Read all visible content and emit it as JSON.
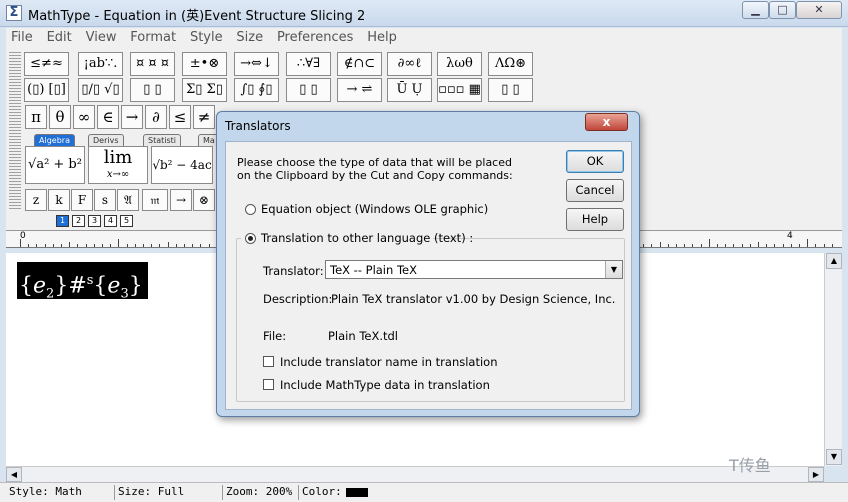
{
  "window": {
    "title": "MathType - Equation in (英)Event Structure Slicing 2",
    "app_icon": "Σ",
    "buttons": {
      "minimize": "▁",
      "maximize": "□",
      "close": "✕"
    }
  },
  "menu": [
    "File",
    "Edit",
    "View",
    "Format",
    "Style",
    "Size",
    "Preferences",
    "Help"
  ],
  "palette": {
    "row1": [
      "≤≠≈",
      "¡ab∵.",
      "¤ ¤ ¤",
      "±•⊗",
      "→⇔↓",
      "∴∀∃",
      "∉∩⊂",
      "∂∞ℓ",
      "λωθ",
      "ΛΩ⊛"
    ],
    "row2": [
      "(▯) [▯]",
      "▯/▯ √▯",
      "▯ ▯",
      "Σ▯ Σ▯",
      "∫▯ ∮▯",
      "▯ ▯",
      "→ ⇌",
      "Ū Ụ",
      "▫▫▫ ▦",
      "▯ ▯"
    ],
    "row3": [
      "π",
      "θ",
      "∞",
      "∈",
      "→",
      "∂",
      "≤",
      "≠"
    ],
    "tabs": [
      "Algebra",
      "Derivs",
      "Statisti",
      "Ma"
    ],
    "templates": {
      "sqrt_sum": "√a² + b²",
      "lim_top": "lim",
      "lim_bottom": "x→∞",
      "sqrt_disc": "√b² − 4ac"
    },
    "row5": [
      "z",
      "k",
      "F",
      "s",
      "𝔄",
      "𝔪",
      "→",
      "⊗"
    ],
    "size_tabs": [
      "1",
      "2",
      "3",
      "4",
      "5"
    ]
  },
  "ruler": {
    "start": "0",
    "end": "4"
  },
  "document": {
    "equation": {
      "e1_base": "e",
      "e1_sub": "2",
      "op": "#",
      "op_sup": "s",
      "e2_base": "e",
      "e2_sub": "3"
    },
    "watermark": "T传鱼"
  },
  "status": {
    "style": "Style: Math",
    "size": "Size: Full",
    "zoom": "Zoom: 200%",
    "color_label": "Color:",
    "color_value": "#000000"
  },
  "dialog": {
    "title": "Translators",
    "close_label": "x",
    "prompt_line1": "Please choose the type of data that will be placed",
    "prompt_line2": "on the Clipboard by the Cut and Copy commands:",
    "ok_label": "OK",
    "cancel_label": "Cancel",
    "help_label": "Help",
    "option_ole": "Equation object (Windows OLE graphic)",
    "option_translation": "Translation to other language (text) :",
    "selected_option": "translation",
    "translator_label": "Translator:",
    "translator_value": "TeX -- Plain TeX",
    "description_label": "Description:",
    "description_value": "Plain TeX translator v1.00 by Design Science, Inc.",
    "file_label": "File:",
    "file_value": "Plain TeX.tdl",
    "check_name": "Include translator name in translation",
    "check_mathtype": "Include MathType data in translation",
    "check_name_checked": false,
    "check_mathtype_checked": false
  }
}
